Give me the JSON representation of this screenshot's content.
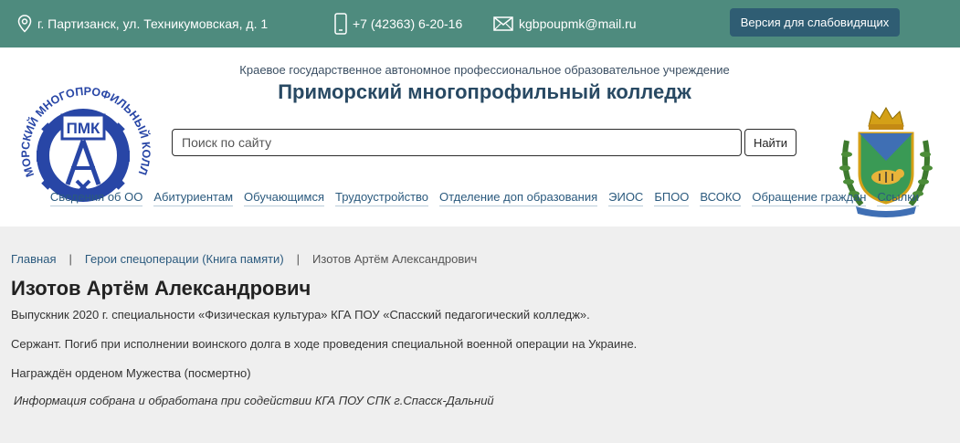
{
  "topbar": {
    "address": "г. Партизанск, ул. Техникумовская, д. 1",
    "phone": "+7 (42363) 6-20-16",
    "email": "kgbpoupmk@mail.ru",
    "vision_button": "Версия для слабовидящих",
    "color": "#4e8b7e"
  },
  "header": {
    "subtitle": "Краевое государственное автономное профессиональное образовательное учреждение",
    "title": "Приморский многопрофильный колледж",
    "logo_text_ring": "ПРИМОРСКИЙ МНОГОПРОФИЛЬНЫЙ КОЛЛЕДЖ",
    "logo_abbr": "ПМК"
  },
  "search": {
    "placeholder": "Поиск по сайту",
    "button": "Найти"
  },
  "nav": [
    "Сведения об ОО",
    "Абитуриентам",
    "Обучающимся",
    "Трудоустройство",
    "Отделение доп образования",
    "ЭИОС",
    "БПОО",
    "ВСОКО",
    "Обращение граждан",
    "Ссылки"
  ],
  "breadcrumb": {
    "home": "Главная",
    "section": "Герои спецоперации (Книга памяти)",
    "current": "Изотов Артём Александрович"
  },
  "page": {
    "title": "Изотов Артём Александрович",
    "p1": "Выпускник 2020 г. специальности «Физическая культура» КГА ПОУ «Спасский педагогический колледж».",
    "p2": "Сержант. Погиб при исполнении воинского долга в ходе проведения специальной военной операции на Украине.",
    "p3": "Награждён орденом Мужества (посмертно)",
    "note": " Информация собрана и обработана при содействии КГА ПОУ СПК г.Спасск-Дальний"
  }
}
